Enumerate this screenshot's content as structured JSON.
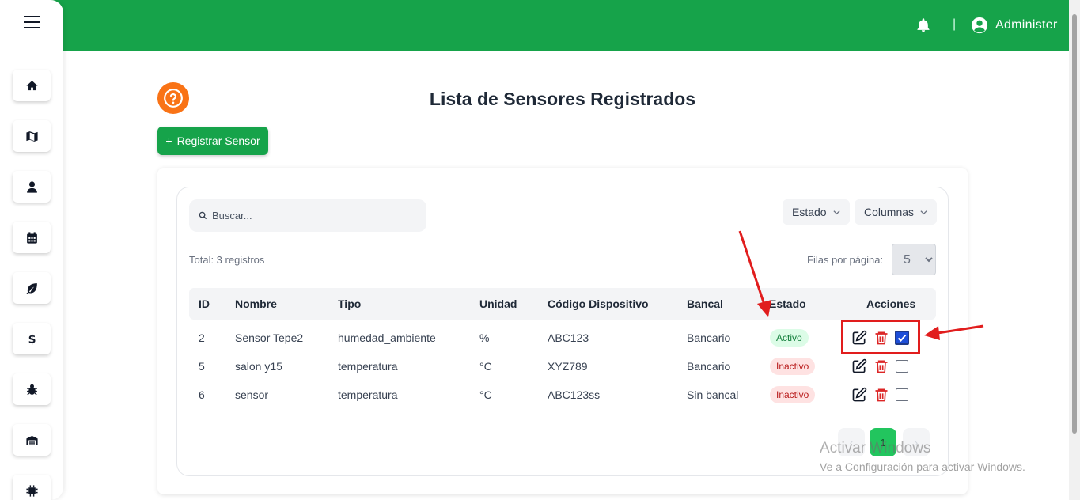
{
  "header": {
    "separator": "|",
    "user_name": "Administer",
    "bell_icon": "bell-icon",
    "user_icon": "user-circle-icon"
  },
  "sidebar": {
    "menu_icon": "hamburger-icon",
    "items": [
      {
        "icon": "home-icon"
      },
      {
        "icon": "map-icon"
      },
      {
        "icon": "user-icon"
      },
      {
        "icon": "calendar-icon"
      },
      {
        "icon": "leaf-icon"
      },
      {
        "icon": "dollar-icon"
      },
      {
        "icon": "bug-icon"
      },
      {
        "icon": "warehouse-icon"
      },
      {
        "icon": "chip-icon"
      }
    ]
  },
  "page": {
    "title": "Lista de Sensores Registrados",
    "help_icon": "question-circle-icon"
  },
  "toolbar": {
    "register_label": "Registrar Sensor",
    "search_placeholder": "Buscar...",
    "estado_label": "Estado",
    "columnas_label": "Columnas",
    "total_text": "Total: 3 registros",
    "rows_label": "Filas por página:",
    "rows_value": "5"
  },
  "table": {
    "headers": [
      "ID",
      "Nombre",
      "Tipo",
      "Unidad",
      "Código Dispositivo",
      "Bancal",
      "Estado",
      "Acciones"
    ],
    "rows": [
      {
        "id": "2",
        "nombre": "Sensor Tepe2",
        "tipo": "humedad_ambiente",
        "unidad": "%",
        "codigo": "ABC123",
        "bancal": "Bancario",
        "estado": "Activo",
        "checked": true
      },
      {
        "id": "5",
        "nombre": "salon y15",
        "tipo": "temperatura",
        "unidad": "°C",
        "codigo": "XYZ789",
        "bancal": "Bancario",
        "estado": "Inactivo",
        "checked": false
      },
      {
        "id": "6",
        "nombre": "sensor",
        "tipo": "temperatura",
        "unidad": "°C",
        "codigo": "ABC123ss",
        "bancal": "Sin bancal",
        "estado": "Inactivo",
        "checked": false
      }
    ]
  },
  "pagination": {
    "prev": "‹",
    "current": "1",
    "next": "›"
  },
  "watermark": {
    "line1": "Activar Windows",
    "line2": "Ve a Configuración para activar Windows."
  },
  "colors": {
    "brand_green": "#16a34a",
    "help_orange": "#f97316",
    "annotation_red": "#e11d1d"
  }
}
